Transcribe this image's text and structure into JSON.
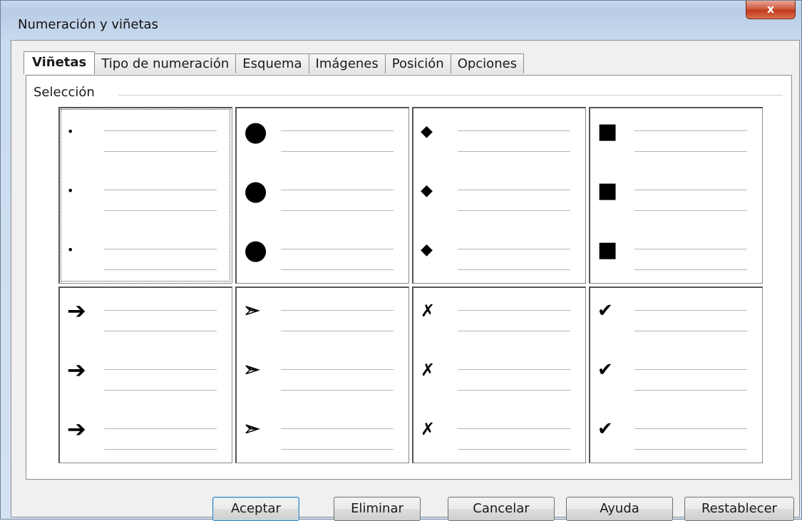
{
  "window": {
    "title": "Numeración y viñetas",
    "close_label": "x"
  },
  "tabs": [
    {
      "label": "Viñetas",
      "active": true
    },
    {
      "label": "Tipo de numeración",
      "active": false
    },
    {
      "label": "Esquema",
      "active": false
    },
    {
      "label": "Imágenes",
      "active": false
    },
    {
      "label": "Posición",
      "active": false
    },
    {
      "label": "Opciones",
      "active": false
    }
  ],
  "selection": {
    "label": "Selección",
    "bullets": [
      {
        "icon": "small-dot-icon",
        "glyph": "•",
        "selected": true
      },
      {
        "icon": "large-dot-icon",
        "glyph": "●",
        "selected": false
      },
      {
        "icon": "diamond-icon",
        "glyph": "◆",
        "selected": false
      },
      {
        "icon": "square-icon",
        "glyph": "■",
        "selected": false
      },
      {
        "icon": "bold-arrow-icon",
        "glyph": "➔",
        "selected": false
      },
      {
        "icon": "arrowhead-icon",
        "glyph": "➢",
        "selected": false
      },
      {
        "icon": "cross-icon",
        "glyph": "✗",
        "selected": false
      },
      {
        "icon": "checkmark-icon",
        "glyph": "✔",
        "selected": false
      }
    ]
  },
  "buttons": {
    "ok": "Aceptar",
    "delete": "Eliminar",
    "cancel": "Cancelar",
    "help": "Ayuda",
    "reset": "Restablecer"
  }
}
